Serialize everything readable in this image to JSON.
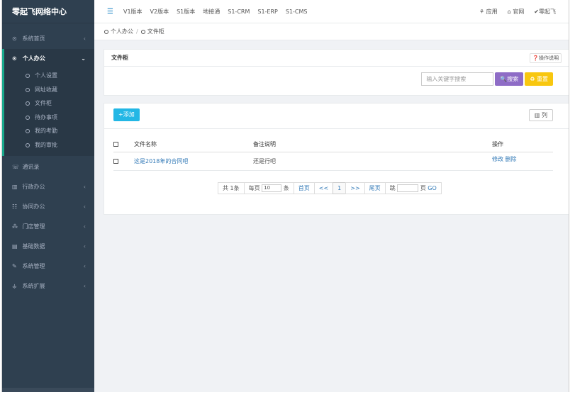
{
  "brand": "零起飞网络中心",
  "sidebar": {
    "items": [
      {
        "label": "系统首页",
        "icon": "dashboard-icon",
        "glyph": "⊙"
      },
      {
        "label": "个人办公",
        "icon": "target-icon",
        "glyph": "⊙"
      },
      {
        "label": "通讯录",
        "icon": "phone-icon",
        "glyph": "☏"
      },
      {
        "label": "行政办公",
        "icon": "building-icon",
        "glyph": "▥"
      },
      {
        "label": "协同办公",
        "icon": "users-icon",
        "glyph": "☷"
      },
      {
        "label": "门店管理",
        "icon": "sitemap-icon",
        "glyph": "⁂"
      },
      {
        "label": "基础数据",
        "icon": "database-icon",
        "glyph": "▤"
      },
      {
        "label": "系统管理",
        "icon": "wrench-icon",
        "glyph": "✎"
      },
      {
        "label": "系统扩展",
        "icon": "plugin-icon",
        "glyph": "⚶"
      }
    ],
    "subitems": [
      "个人设置",
      "网址收藏",
      "文件柜",
      "待办事项",
      "我的考勤",
      "我的审批"
    ]
  },
  "topnav": {
    "menu_glyph": "☰",
    "items": [
      "V1版本",
      "V2版本",
      "S1版本",
      "地接通",
      "S1-CRM",
      "S1-ERP",
      "S1-CMS"
    ],
    "right": [
      "⚘ 应用",
      "⌂ 官网",
      "✔零起飞"
    ]
  },
  "breadcrumb": [
    "个人办公",
    "文件柜"
  ],
  "panel": {
    "title": "文件柜",
    "help": "❓操作说明",
    "search_placeholder": "输入关键字搜索",
    "search_btn": "🔍搜索",
    "reset_btn": "♻ 重置"
  },
  "list": {
    "add_btn": "+添加",
    "col_btn": "▥ 列",
    "headers": {
      "name": "文件名称",
      "note": "备注说明",
      "ops": "操作"
    },
    "rows": [
      {
        "name": "这是2018年的合同吧",
        "note": "还是行吧",
        "edit": "修改",
        "delete": "删除"
      }
    ]
  },
  "pager": {
    "total": "共 1条",
    "per_page_label": "每页",
    "per_page": "10",
    "unit": "条",
    "first": "首页",
    "prev": "<<",
    "current": "1",
    "next": ">>",
    "last": "尾页",
    "jump": "跳",
    "page_unit": "页",
    "go": "GO"
  }
}
